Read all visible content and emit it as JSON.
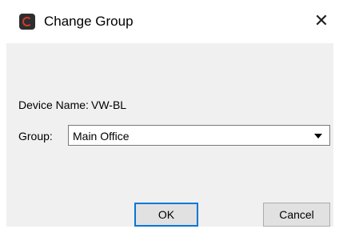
{
  "window": {
    "title": "Change Group",
    "close_symbol": "✕"
  },
  "icons": {
    "app": "app-logo-icon",
    "close": "close-icon",
    "dropdown": "chevron-down-icon"
  },
  "form": {
    "device_name_label": "Device Name:",
    "device_name_value": "VW-BL",
    "group_label": "Group:",
    "group_selected": "Main Office"
  },
  "buttons": {
    "ok_label": "OK",
    "cancel_label": "Cancel"
  },
  "colors": {
    "focus_border": "#0078d7",
    "client_background": "#f0f0f0",
    "app_icon_accent": "#d23a2a"
  }
}
